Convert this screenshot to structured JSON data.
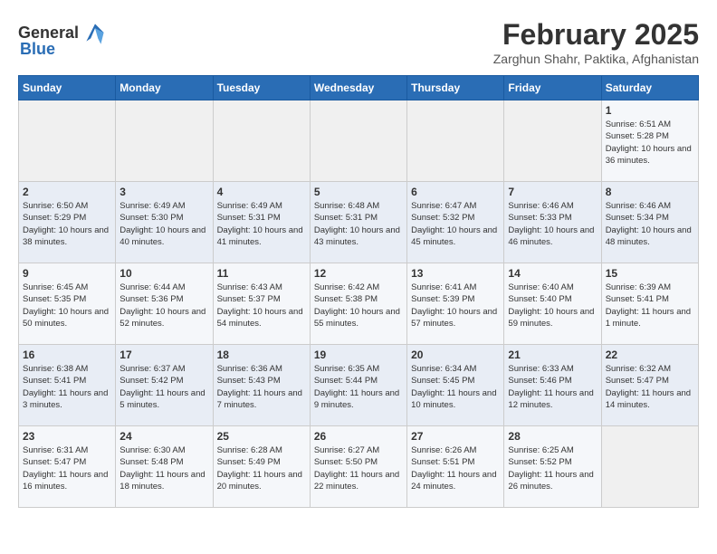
{
  "logo": {
    "text_general": "General",
    "text_blue": "Blue"
  },
  "title": "February 2025",
  "subtitle": "Zarghun Shahr, Paktika, Afghanistan",
  "days_of_week": [
    "Sunday",
    "Monday",
    "Tuesday",
    "Wednesday",
    "Thursday",
    "Friday",
    "Saturday"
  ],
  "weeks": [
    [
      {
        "day": "",
        "info": ""
      },
      {
        "day": "",
        "info": ""
      },
      {
        "day": "",
        "info": ""
      },
      {
        "day": "",
        "info": ""
      },
      {
        "day": "",
        "info": ""
      },
      {
        "day": "",
        "info": ""
      },
      {
        "day": "1",
        "info": "Sunrise: 6:51 AM\nSunset: 5:28 PM\nDaylight: 10 hours and 36 minutes."
      }
    ],
    [
      {
        "day": "2",
        "info": "Sunrise: 6:50 AM\nSunset: 5:29 PM\nDaylight: 10 hours and 38 minutes."
      },
      {
        "day": "3",
        "info": "Sunrise: 6:49 AM\nSunset: 5:30 PM\nDaylight: 10 hours and 40 minutes."
      },
      {
        "day": "4",
        "info": "Sunrise: 6:49 AM\nSunset: 5:31 PM\nDaylight: 10 hours and 41 minutes."
      },
      {
        "day": "5",
        "info": "Sunrise: 6:48 AM\nSunset: 5:31 PM\nDaylight: 10 hours and 43 minutes."
      },
      {
        "day": "6",
        "info": "Sunrise: 6:47 AM\nSunset: 5:32 PM\nDaylight: 10 hours and 45 minutes."
      },
      {
        "day": "7",
        "info": "Sunrise: 6:46 AM\nSunset: 5:33 PM\nDaylight: 10 hours and 46 minutes."
      },
      {
        "day": "8",
        "info": "Sunrise: 6:46 AM\nSunset: 5:34 PM\nDaylight: 10 hours and 48 minutes."
      }
    ],
    [
      {
        "day": "9",
        "info": "Sunrise: 6:45 AM\nSunset: 5:35 PM\nDaylight: 10 hours and 50 minutes."
      },
      {
        "day": "10",
        "info": "Sunrise: 6:44 AM\nSunset: 5:36 PM\nDaylight: 10 hours and 52 minutes."
      },
      {
        "day": "11",
        "info": "Sunrise: 6:43 AM\nSunset: 5:37 PM\nDaylight: 10 hours and 54 minutes."
      },
      {
        "day": "12",
        "info": "Sunrise: 6:42 AM\nSunset: 5:38 PM\nDaylight: 10 hours and 55 minutes."
      },
      {
        "day": "13",
        "info": "Sunrise: 6:41 AM\nSunset: 5:39 PM\nDaylight: 10 hours and 57 minutes."
      },
      {
        "day": "14",
        "info": "Sunrise: 6:40 AM\nSunset: 5:40 PM\nDaylight: 10 hours and 59 minutes."
      },
      {
        "day": "15",
        "info": "Sunrise: 6:39 AM\nSunset: 5:41 PM\nDaylight: 11 hours and 1 minute."
      }
    ],
    [
      {
        "day": "16",
        "info": "Sunrise: 6:38 AM\nSunset: 5:41 PM\nDaylight: 11 hours and 3 minutes."
      },
      {
        "day": "17",
        "info": "Sunrise: 6:37 AM\nSunset: 5:42 PM\nDaylight: 11 hours and 5 minutes."
      },
      {
        "day": "18",
        "info": "Sunrise: 6:36 AM\nSunset: 5:43 PM\nDaylight: 11 hours and 7 minutes."
      },
      {
        "day": "19",
        "info": "Sunrise: 6:35 AM\nSunset: 5:44 PM\nDaylight: 11 hours and 9 minutes."
      },
      {
        "day": "20",
        "info": "Sunrise: 6:34 AM\nSunset: 5:45 PM\nDaylight: 11 hours and 10 minutes."
      },
      {
        "day": "21",
        "info": "Sunrise: 6:33 AM\nSunset: 5:46 PM\nDaylight: 11 hours and 12 minutes."
      },
      {
        "day": "22",
        "info": "Sunrise: 6:32 AM\nSunset: 5:47 PM\nDaylight: 11 hours and 14 minutes."
      }
    ],
    [
      {
        "day": "23",
        "info": "Sunrise: 6:31 AM\nSunset: 5:47 PM\nDaylight: 11 hours and 16 minutes."
      },
      {
        "day": "24",
        "info": "Sunrise: 6:30 AM\nSunset: 5:48 PM\nDaylight: 11 hours and 18 minutes."
      },
      {
        "day": "25",
        "info": "Sunrise: 6:28 AM\nSunset: 5:49 PM\nDaylight: 11 hours and 20 minutes."
      },
      {
        "day": "26",
        "info": "Sunrise: 6:27 AM\nSunset: 5:50 PM\nDaylight: 11 hours and 22 minutes."
      },
      {
        "day": "27",
        "info": "Sunrise: 6:26 AM\nSunset: 5:51 PM\nDaylight: 11 hours and 24 minutes."
      },
      {
        "day": "28",
        "info": "Sunrise: 6:25 AM\nSunset: 5:52 PM\nDaylight: 11 hours and 26 minutes."
      },
      {
        "day": "",
        "info": ""
      }
    ]
  ]
}
